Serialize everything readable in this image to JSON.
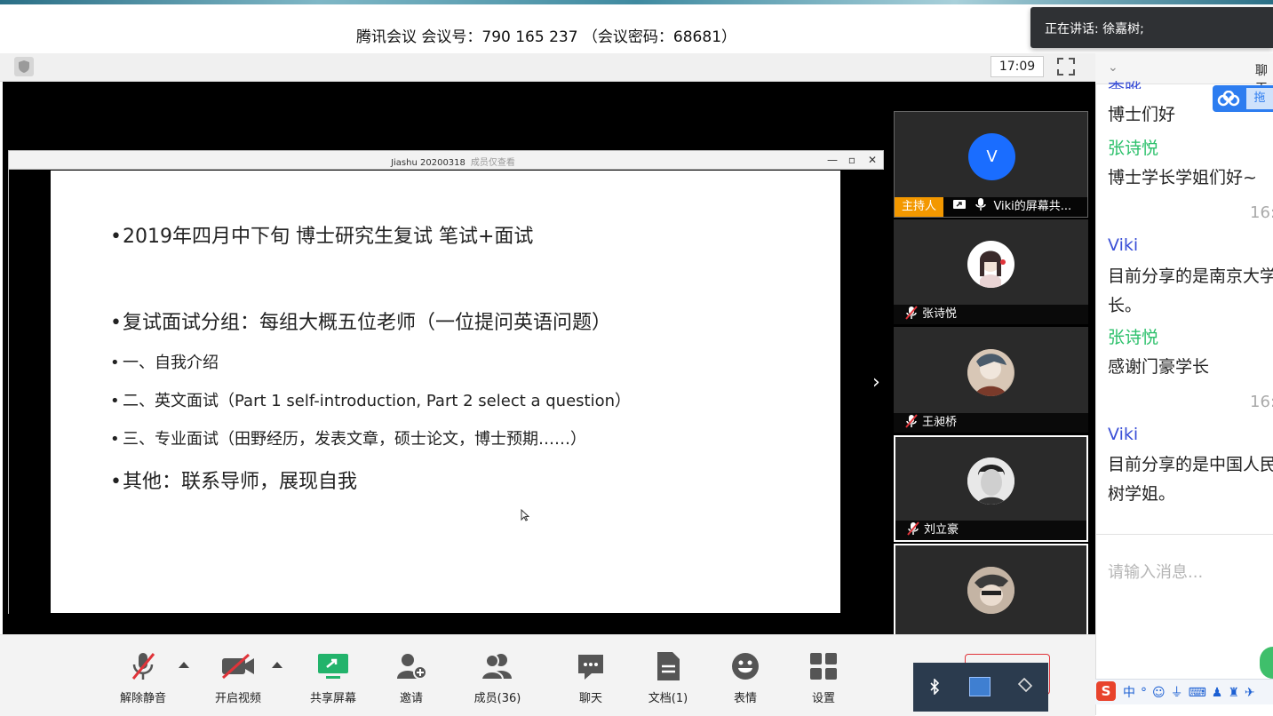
{
  "window": {
    "meeting_title": "腾讯会议 会议号：790 165 237 （会议密码：68681）",
    "speaking": "正在讲话: 徐嘉树;",
    "clock": "17:09"
  },
  "shared_window": {
    "title": "Jiashu 20200318",
    "subtitle": "成员仅查看"
  },
  "slide": {
    "bullets": [
      "2019年四月中下旬 博士研究生复试 笔试+面试",
      "复试面试分组：每组大概五位老师（一位提问英语问题）",
      "一、自我介绍",
      "二、英文面试（Part 1 self-introduction, Part 2 select a question）",
      "三、专业面试（田野经历，发表文章，硕士论文，博士预期……）",
      "其他：联系导师，展现自我"
    ]
  },
  "participants": [
    {
      "avatar_letter": "V",
      "host_badge": "主持人",
      "name": "Viki的屏幕共..."
    },
    {
      "name": "张诗悦"
    },
    {
      "name": "王昶桥"
    },
    {
      "name": "刘立豪"
    }
  ],
  "chat": {
    "header_label": "聊天",
    "messages": [
      {
        "sender": "李晔",
        "text": "博士们好"
      },
      {
        "sender": "张诗悦",
        "text": "博士学长学姐们好~"
      },
      {
        "time": "16:"
      },
      {
        "sender": "Viki",
        "text_line1": "目前分享的是南京大学",
        "text_line2": "长。"
      },
      {
        "sender": "张诗悦",
        "text": "感谢门豪学长"
      },
      {
        "time": "16:"
      },
      {
        "sender": "Viki",
        "text_line1": "目前分享的是中国人民",
        "text_line2": "树学姐。"
      }
    ],
    "input_placeholder": "请输入消息...",
    "drag_button": "拖"
  },
  "toolbar": {
    "unmute": "解除静音",
    "start_video": "开启视频",
    "share_screen": "共享屏幕",
    "invite": "邀请",
    "members": "成员(36)",
    "chat": "聊天",
    "docs": "文档(1)",
    "emoji": "表情",
    "settings": "设置"
  },
  "colors": {
    "accent_green": "#22b36b",
    "host_orange": "#f39800",
    "chat_blue_name": "#3a4fd6",
    "chat_green_name": "#2bc06a",
    "mute_red": "#e0343a"
  }
}
